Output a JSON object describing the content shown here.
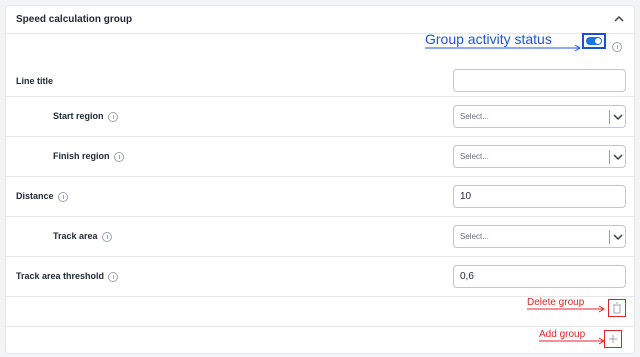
{
  "header": {
    "title": "Speed calculation group",
    "collapse_icon": "chevron-up-icon"
  },
  "group_status": {
    "annotation": "Group activity status",
    "enabled": true,
    "accent_color": "#1a73e8"
  },
  "fields": {
    "line_title": {
      "label": "Line title",
      "value": ""
    },
    "start_region": {
      "label": "Start region",
      "value": "Select..."
    },
    "finish_region": {
      "label": "Finish region",
      "value": "Select..."
    },
    "distance": {
      "label": "Distance",
      "value": "10"
    },
    "track_area": {
      "label": "Track area",
      "value": "Select..."
    },
    "track_area_threshold": {
      "label": "Track area threshold",
      "value": "0,6"
    }
  },
  "actions": {
    "delete_annotation": "Delete group",
    "add_annotation": "Add group",
    "annotation_color": "#dc2626"
  }
}
